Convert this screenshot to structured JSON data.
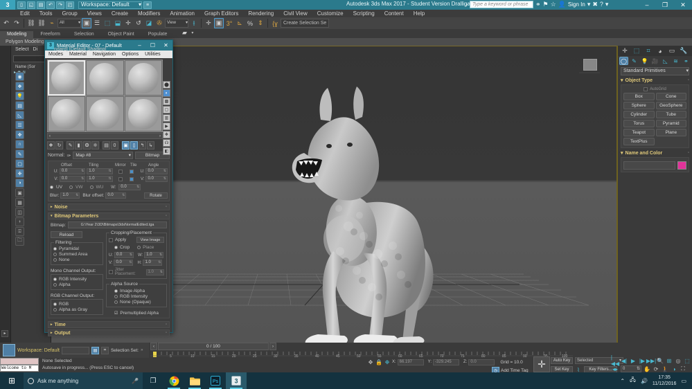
{
  "titlebar": {
    "logo": "3 MAX",
    "workspace": "Workspace: Default",
    "app_title": "Autodesk 3ds Max 2017 - Student Version    Dralligator Final.max",
    "search_placeholder": "Type a keyword or phrase",
    "signin": "Sign In",
    "min": "–",
    "max": "❐",
    "close": "✕",
    "qat": [
      "new-icon",
      "open-icon",
      "save-icon",
      "undo-icon",
      "redo-icon",
      "set-project-icon"
    ],
    "accent": "#2b7a8c"
  },
  "menubar": {
    "items": [
      "Edit",
      "Tools",
      "Group",
      "Views",
      "Create",
      "Modifiers",
      "Animation",
      "Graph Editors",
      "Rendering",
      "Civil View",
      "Customize",
      "Scripting",
      "Content",
      "Help"
    ]
  },
  "toolbar": {
    "filter_value": "All",
    "ref_coord_value": "View",
    "selection_set_placeholder": "Create Selection Se",
    "icons": [
      "undo",
      "redo",
      "select-link",
      "unlink",
      "bind-space-warp",
      "select-object",
      "select-by-name",
      "rect-select",
      "window-crossing",
      "select-move",
      "select-rotate",
      "select-scale",
      "reference-coord",
      "align-center",
      "mirror",
      "align",
      "snaps-toggle",
      "angle-snap",
      "percent-snap",
      "spinner-snap",
      "named-sets"
    ]
  },
  "ribbon": {
    "tabs": [
      "Modeling",
      "Freeform",
      "Selection",
      "Object Paint",
      "Populate"
    ],
    "active": "Modeling",
    "subrow": "Polygon Modeling"
  },
  "scene_explorer": {
    "menu": [
      "Select",
      "Di"
    ],
    "header": "Name (Sor"
  },
  "viewport": {
    "label": "ndard] [Default Shading]",
    "view_cube": "view-cube"
  },
  "material_editor": {
    "title": "Material Editor - 07 - Default",
    "min": "–",
    "max": "☐",
    "close": "✕",
    "menu": [
      "Modes",
      "Material",
      "Navigation",
      "Options",
      "Utilities"
    ],
    "slot_count": 6,
    "selected_slot": 0,
    "scroll_left": "‹",
    "scroll_right": "›",
    "normal_label": "Normal:",
    "map_name": "Map #8",
    "bitmap_button": "Bitmap",
    "coords": {
      "headers": [
        "Offset",
        "Tiling",
        "Mirror",
        "Tile",
        "Angle"
      ],
      "u_label": "U:",
      "v_label": "V:",
      "w_label": "W:",
      "u_offset": "0.0",
      "v_offset": "0.0",
      "u_tiling": "1.0",
      "v_tiling": "1.0",
      "u_mirror": false,
      "v_mirror": false,
      "u_tile": true,
      "v_tile": true,
      "u_angle": "0.0",
      "v_angle": "0.0",
      "w_angle": "0.0",
      "uv_modes": [
        "UV",
        "VW",
        "WU"
      ],
      "uv_selected": "UV",
      "blur_label": "Blur:",
      "blur_value": "1.0",
      "blur_offset_label": "Blur offset:",
      "blur_offset_value": "0.0",
      "rotate_button": "Rotate"
    },
    "rollups": {
      "noise": "Noise",
      "bitmap_parameters": "Bitmap Parameters",
      "time": "Time",
      "output": "Output"
    },
    "bitmap": {
      "bitmap_label": "Bitmap:",
      "bitmap_path": "G:\\Year 2\\3D\\Bitmaps\\3dsNormalEdited.tga",
      "reload_button": "Reload",
      "filtering_group": "Filtering",
      "filtering_options": [
        "Pyramidal",
        "Summed Area",
        "None"
      ],
      "filtering_selected": "Pyramidal",
      "mono_group": "Mono Channel Output:",
      "mono_options": [
        "RGB Intensity",
        "Alpha"
      ],
      "mono_selected": "RGB Intensity",
      "rgb_group": "RGB Channel Output:",
      "rgb_options": [
        "RGB",
        "Alpha as Gray"
      ],
      "rgb_selected": "RGB",
      "cropping_group": "Cropping/Placement",
      "apply_label": "Apply",
      "apply_checked": false,
      "view_image_button": "View Image",
      "crop_place_options": [
        "Crop",
        "Place"
      ],
      "crop_place_selected": "Crop",
      "u_label": "U:",
      "u_value": "0.0",
      "v_label": "V:",
      "v_value": "0.0",
      "w_label": "W:",
      "w_value": "1.0",
      "h_label": "H:",
      "h_value": "1.0",
      "jitter_label": "Jitter Placement:",
      "jitter_value": "1.0",
      "alpha_group": "Alpha Source",
      "alpha_options": [
        "Image Alpha",
        "RGB Intensity",
        "None (Opaque)"
      ],
      "alpha_selected": "Image Alpha",
      "premultiplied_label": "Premultiplied Alpha",
      "premultiplied_checked": true
    }
  },
  "command_panel": {
    "tabs": [
      "create-tab",
      "modify-tab",
      "hierarchy-tab",
      "motion-tab",
      "display-tab",
      "utilities-tab"
    ],
    "active_tab": "create-tab",
    "subtabs": [
      "geometry-icon",
      "shapes-icon",
      "lights-icon",
      "cameras-icon",
      "helpers-icon",
      "space-warps-icon",
      "systems-icon"
    ],
    "active_subtab": "geometry-icon",
    "category": "Standard Primitives",
    "object_type_rollup": "Object Type",
    "autogrid_label": "AutoGrid",
    "autogrid_checked": false,
    "object_buttons": [
      "Box",
      "Cone",
      "Sphere",
      "GeoSphere",
      "Cylinder",
      "Tube",
      "Torus",
      "Pyramid",
      "Teapot",
      "Plane",
      "TextPlus"
    ],
    "name_color_rollup": "Name and Color",
    "name_value": "",
    "color_swatch": "#e0339a"
  },
  "status": {
    "workspace_label": "Workspace: Default",
    "selection_set_label": "Selection Set:",
    "time_field": "0 / 100",
    "prev_arrow": "‹",
    "next_arrow": "›",
    "ruler_ticks": [
      5,
      10,
      15,
      20,
      25,
      30,
      35,
      40,
      45,
      50,
      55,
      60,
      65,
      70,
      75,
      80,
      85,
      90,
      95,
      100
    ],
    "maxscript_line": "Welcome to M",
    "selection_status": "None Selected",
    "prompt_status": "Autosave in progress... (Press ESC to cancel)",
    "x_label": "X:",
    "x_value": "66.197",
    "y_label": "Y:",
    "y_value": "-329.245",
    "z_label": "Z:",
    "z_value": "0.0",
    "grid_label": "Grid = 10.0",
    "add_time_tag": "Add Time Tag",
    "auto_key": "Auto Key",
    "set_key": "Set Key",
    "key_filters": "Key Filters...",
    "selected_dropdown": "Selected",
    "key_index": "0"
  },
  "taskbar": {
    "search_placeholder": "Ask me anything",
    "apps": [
      "task-view-icon",
      "chrome-icon",
      "file-explorer-icon",
      "photoshop-icon",
      "3dsmax-icon"
    ],
    "active_app": "3dsmax-icon",
    "clock_time": "17:35",
    "clock_date": "11/12/2016",
    "tray": [
      "chevron-up-icon",
      "network-icon",
      "volume-icon"
    ]
  }
}
